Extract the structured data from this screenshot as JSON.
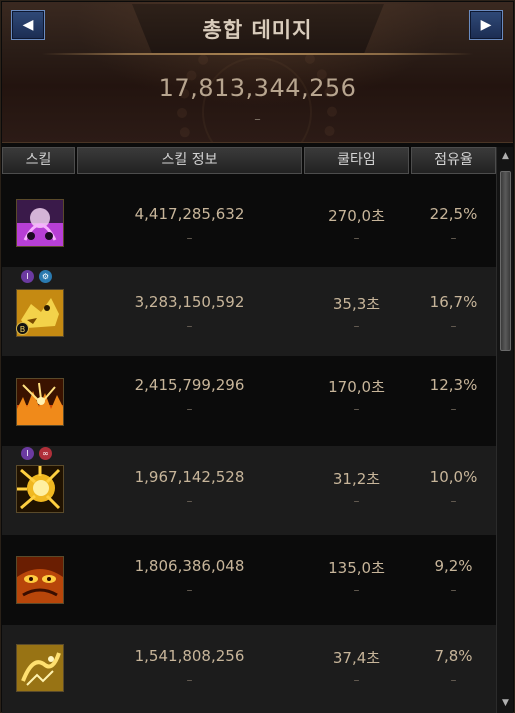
{
  "header": {
    "title": "총합 데미지",
    "total_damage": "17,813,344,256",
    "total_sub": "–",
    "prev_glyph": "◀",
    "next_glyph": "▶"
  },
  "columns": [
    "스킬",
    "스킬 정보",
    "쿨타임",
    "점유율"
  ],
  "rows": [
    {
      "icon": "purple-spirit-skill-icon",
      "damage": "4,417,285,632",
      "cooldown": "270,0초",
      "share": "22,5%",
      "dash": "–"
    },
    {
      "icon": "golden-beast-skill-icon",
      "damage": "3,283,150,592",
      "cooldown": "35,3초",
      "share": "16,7%",
      "dash": "–",
      "badge": "B"
    },
    {
      "icon": "fire-burst-skill-icon",
      "damage": "2,415,799,296",
      "cooldown": "170,0초",
      "share": "12,3%",
      "dash": "–"
    },
    {
      "icon": "yellow-explosion-skill-icon",
      "damage": "1,967,142,528",
      "cooldown": "31,2초",
      "share": "10,0%",
      "dash": "–"
    },
    {
      "icon": "fire-eyes-skill-icon",
      "damage": "1,806,386,048",
      "cooldown": "135,0초",
      "share": "9,2%",
      "dash": "–"
    },
    {
      "icon": "golden-dragon-skill-icon",
      "damage": "1,541,808,256",
      "cooldown": "37,4초",
      "share": "7,8%",
      "dash": "–"
    }
  ],
  "scrollbar": {
    "up_glyph": "▲",
    "down_glyph": "▼"
  },
  "colors": {
    "accent_gold": "#c7b59a",
    "nav_blue": "#304a78",
    "alt_row": "#1c1c1c"
  }
}
